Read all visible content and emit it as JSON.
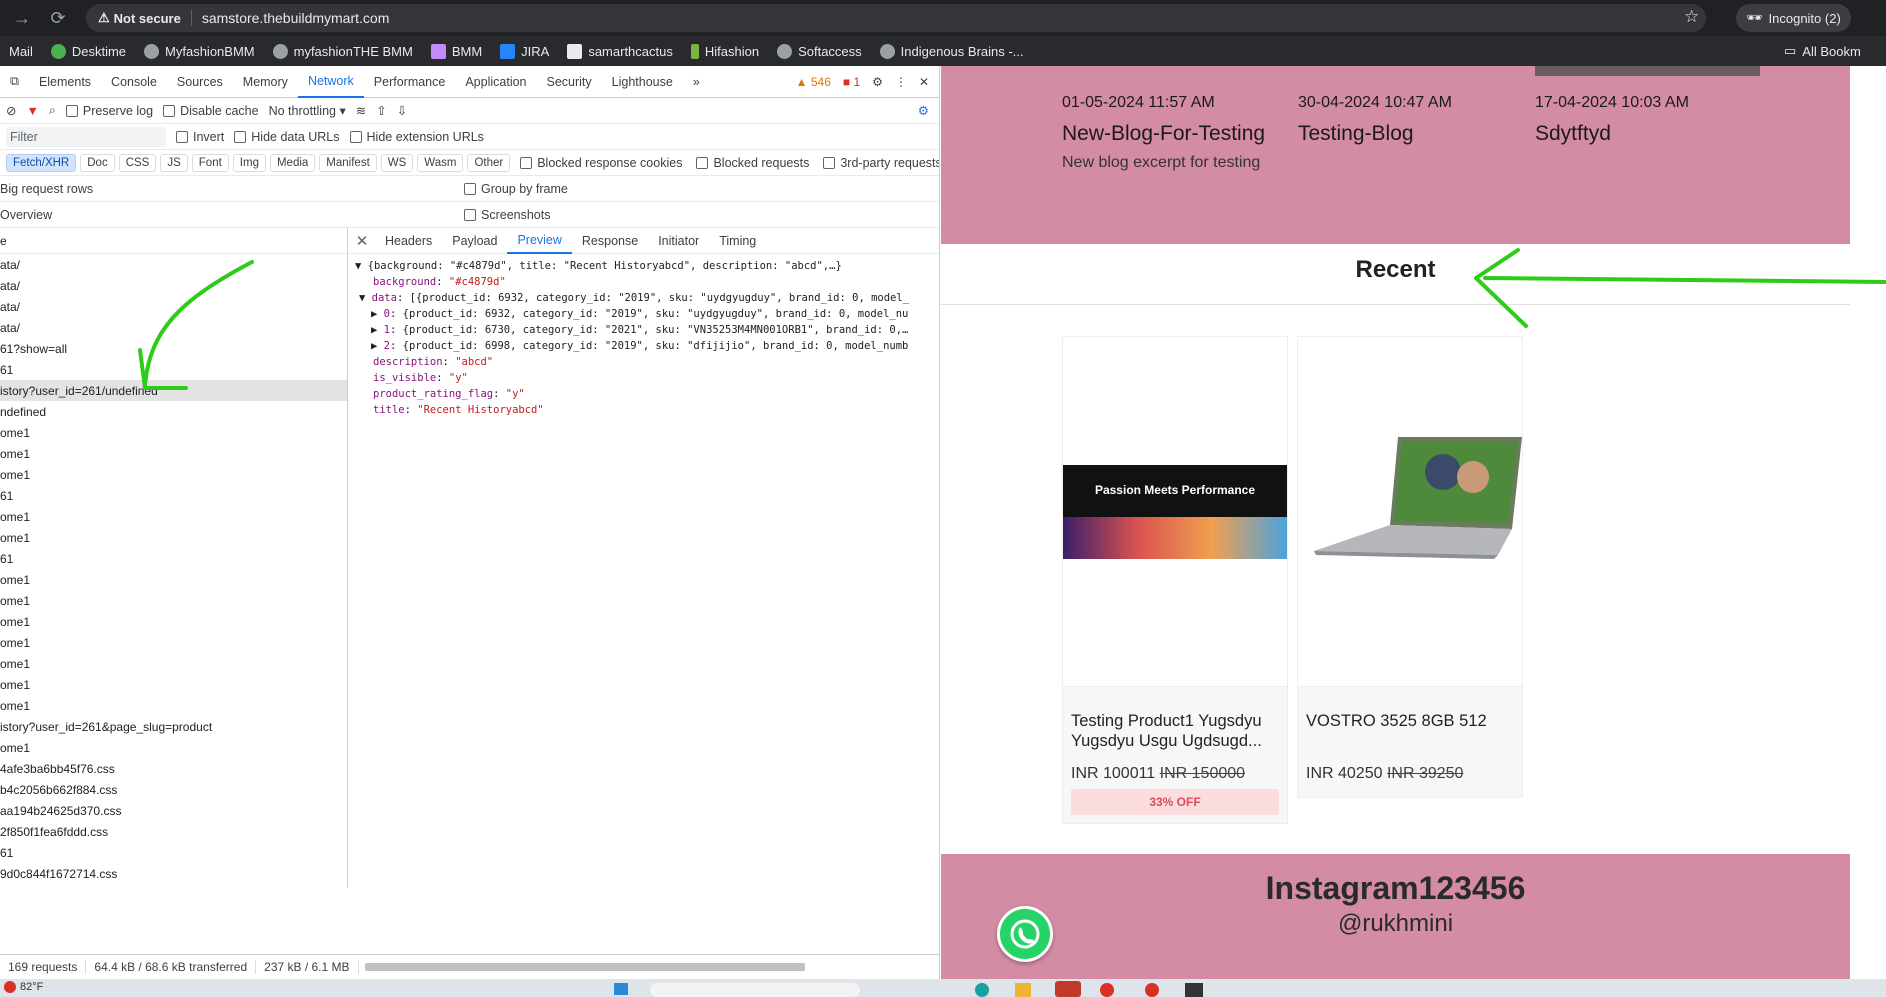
{
  "browser": {
    "not_secure": "Not secure",
    "url": "samstore.thebuildmymart.com",
    "incognito": "Incognito (2)",
    "bookmarks": [
      "Mail",
      "Desktime",
      "MyfashionBMM",
      "myfashionTHE BMM",
      "BMM",
      "JIRA",
      "samarthcactus",
      "Hifashion",
      "Softaccess",
      "Indigenous Brains -..."
    ],
    "all_bookmarks": "All Bookm"
  },
  "devtools": {
    "tabs": [
      "Elements",
      "Console",
      "Sources",
      "Memory",
      "Network",
      "Performance",
      "Application",
      "Security",
      "Lighthouse"
    ],
    "warnings": "546",
    "errors": "1",
    "preserve_log": "Preserve log",
    "disable_cache": "Disable cache",
    "throttling": "No throttling",
    "filter_placeholder": "Filter",
    "invert": "Invert",
    "hide_data_urls": "Hide data URLs",
    "hide_extension_urls": "Hide extension URLs",
    "type_filters": [
      "Fetch/XHR",
      "Doc",
      "CSS",
      "JS",
      "Font",
      "Img",
      "Media",
      "Manifest",
      "WS",
      "Wasm",
      "Other"
    ],
    "blocked_cookies": "Blocked response cookies",
    "blocked_requests": "Blocked requests",
    "third_party": "3rd-party requests",
    "big_rows": "Big request rows",
    "group_by_frame": "Group by frame",
    "overview": "Overview",
    "screenshots": "Screenshots",
    "name_header": "e",
    "requests": [
      "ata/",
      "ata/",
      "ata/",
      "ata/",
      "61?show=all",
      "61",
      "istory?user_id=261/undefined",
      "ndefined",
      "ome1",
      "ome1",
      "ome1",
      "61",
      "ome1",
      "ome1",
      "61",
      "ome1",
      "ome1",
      "ome1",
      "ome1",
      "ome1",
      "ome1",
      "ome1",
      "istory?user_id=261&page_slug=product",
      "ome1",
      "4afe3ba6bb45f76.css",
      "b4c2056b662f884.css",
      "aa194b24625d370.css",
      "2f850f1fea6fddd.css",
      "61",
      "9d0c844f1672714.css"
    ],
    "detail_tabs": [
      "Headers",
      "Payload",
      "Preview",
      "Response",
      "Initiator",
      "Timing"
    ],
    "preview": {
      "root": "{background: \"#c4879d\", title: \"Recent Historyabcd\", description: \"abcd\",…}",
      "background_val": "\"#c4879d\"",
      "data_summary": "[{product_id: 6932, category_id: \"2019\", sku: \"uydgyugduy\", brand_id: 0, model_",
      "item0": "{product_id: 6932, category_id: \"2019\", sku: \"uydgyugduy\", brand_id: 0, model_nu",
      "item1": "{product_id: 6730, category_id: \"2021\", sku: \"VN35253M4MN001ORB1\", brand_id: 0,…",
      "item2": "{product_id: 6998, category_id: \"2019\", sku: \"dfijijio\", brand_id: 0, model_numb",
      "description_val": "\"abcd\"",
      "is_visible_val": "\"y\"",
      "product_rating_flag_val": "\"y\"",
      "title_val": "\"Recent Historyabcd\""
    },
    "status": {
      "requests": "169 requests",
      "transferred": "64.4 kB / 68.6 kB transferred",
      "resources": "237 kB / 6.1 MB"
    }
  },
  "site": {
    "blogs": [
      {
        "date": "01-05-2024 11:57 AM",
        "title": "New-Blog-For-Testing",
        "excerpt": "New blog excerpt for testing"
      },
      {
        "date": "30-04-2024 10:47 AM",
        "title": "Testing-Blog",
        "excerpt": ""
      },
      {
        "date": "17-04-2024 10:03 AM",
        "title": "Sdytftyd",
        "excerpt": ""
      }
    ],
    "recent_title": "Recent",
    "products": [
      {
        "name": "Testing Product1 Yugsdyu Yugsdyu Usgu Ugdsugd...",
        "price": "INR 100011",
        "mrp": "INR 150000",
        "badge": "33% OFF",
        "banner_text": "Passion Meets Performance"
      },
      {
        "name": "VOSTRO 3525 8GB 512",
        "price": "INR 40250",
        "mrp": "INR 39250"
      }
    ],
    "instagram_title": "Instagram123456",
    "instagram_handle": "@rukhmini"
  },
  "taskbar": {
    "weather": "82°F"
  },
  "colors": {
    "band_pink": "#d48ca4",
    "annotation_green": "#2ecc1a",
    "devtools_accent": "#1a73e8"
  }
}
